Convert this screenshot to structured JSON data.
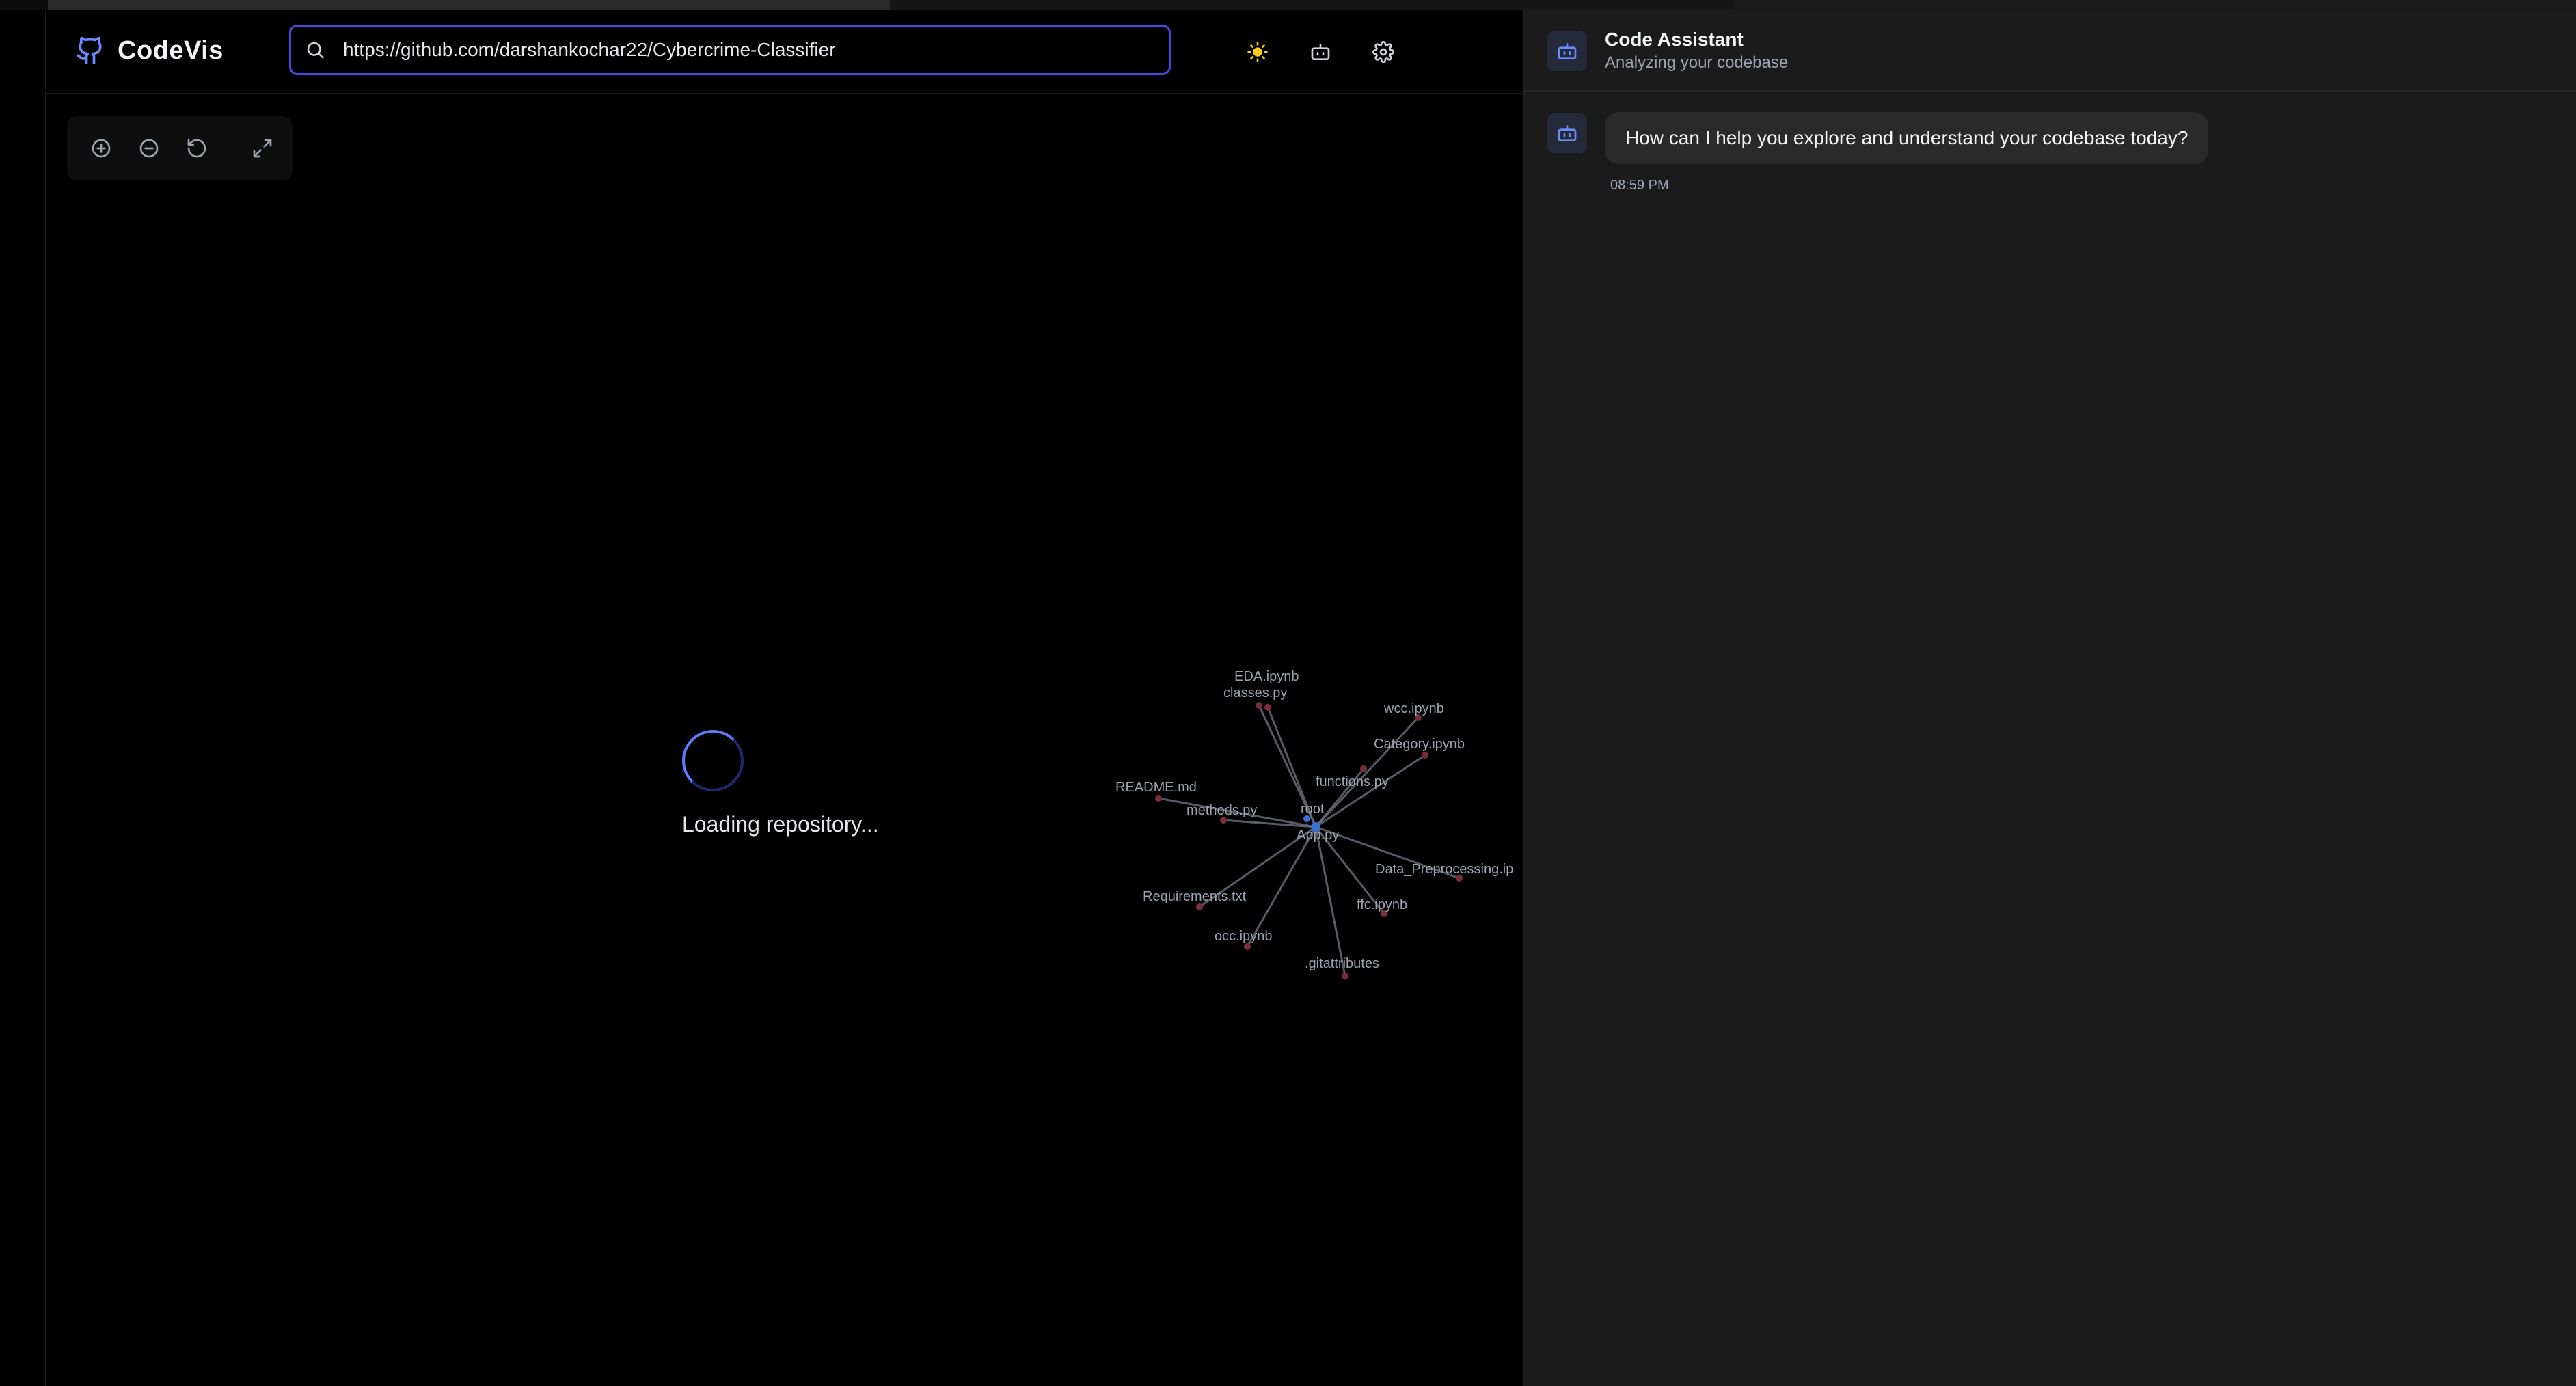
{
  "app": {
    "name": "CodeVis"
  },
  "search": {
    "value": "https://github.com/darshankochar22/Cybercrime-Classifier"
  },
  "header_icons": [
    "sun-icon",
    "bot-icon",
    "gear-icon"
  ],
  "zoom_controls": [
    "zoom-in-icon",
    "zoom-out-icon",
    "reset-icon",
    "fullscreen-icon"
  ],
  "canvas": {
    "loading_text": "Loading repository..."
  },
  "graph": {
    "center": "App.py",
    "root": "root",
    "nodes": [
      "EDA.ipynb",
      "classes.py",
      "wcc.ipynb",
      "Category.ipynb",
      "functions.py",
      "README.md",
      "methods.py",
      "Data_Preprocessing.ip",
      "Requirements.txt",
      "ffc.ipynb",
      "occ.ipynb",
      ".gitattributes"
    ]
  },
  "assistant": {
    "title": "Code Assistant",
    "subtitle": "Analyzing your codebase",
    "message": "How can I help you explore and understand your codebase today?",
    "time": "08:59 PM"
  },
  "colors": {
    "accent": "#4f46e5",
    "icon_blue": "#6b8cff",
    "sun": "#facc15",
    "node": "#7a2e3a",
    "panel_bg": "#1b1b1b"
  }
}
